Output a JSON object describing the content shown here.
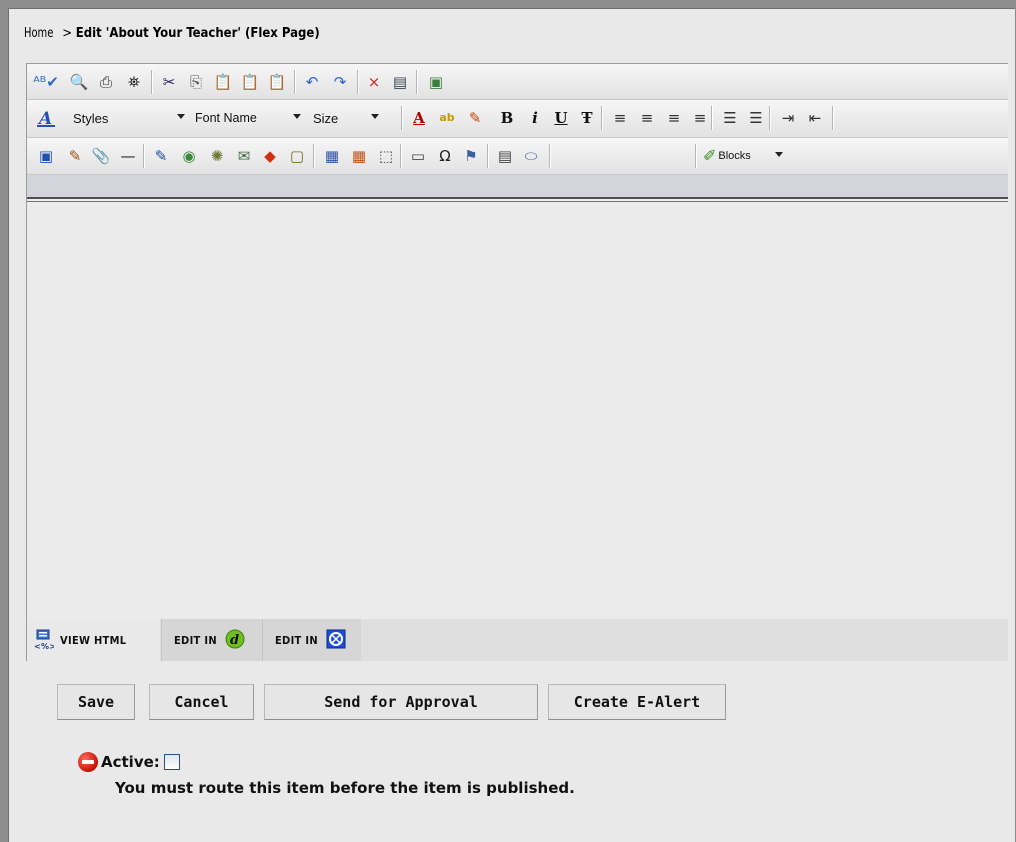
{
  "breadcrumb": {
    "home": "Home",
    "separator": " > ",
    "current": "Edit 'About Your Teacher' (Flex Page)"
  },
  "toolbar": {
    "row1": [
      {
        "name": "spellcheck-icon",
        "glyph": "ᴬᴮ✔",
        "color": "#2a6bbd"
      },
      {
        "name": "find-icon",
        "glyph": "🔍",
        "color": "#345"
      },
      {
        "name": "print-icon",
        "glyph": "⎙",
        "color": "#333"
      },
      {
        "name": "binoculars-icon",
        "glyph": "⛯",
        "color": "#222"
      },
      {
        "name": "cut-icon",
        "glyph": "✂",
        "color": "#225"
      },
      {
        "name": "copy-icon",
        "glyph": "⎘",
        "color": "#555"
      },
      {
        "name": "paste-icon",
        "glyph": "📋",
        "color": "#8a5a1a"
      },
      {
        "name": "paste-word-icon",
        "glyph": "📋",
        "color": "#2a56a5"
      },
      {
        "name": "paste-text-icon",
        "glyph": "📋",
        "color": "#666"
      },
      {
        "name": "undo-icon",
        "glyph": "↶",
        "color": "#2e62c9"
      },
      {
        "name": "redo-icon",
        "glyph": "↷",
        "color": "#2e62c9"
      },
      {
        "name": "delete-icon",
        "glyph": "×",
        "color": "#e02020"
      },
      {
        "name": "select-all-icon",
        "glyph": "▤",
        "color": "#345"
      },
      {
        "name": "preview-icon",
        "glyph": "▣",
        "color": "#3b7d3b"
      }
    ],
    "styles_label": "Styles",
    "font_name_label": "Font Name",
    "size_label": "Size",
    "format_icons": [
      {
        "name": "font-color-icon",
        "glyph": "A",
        "color": "#b00000"
      },
      {
        "name": "highlight-icon",
        "glyph": "ab",
        "color": "#c79a00"
      },
      {
        "name": "format-brush-icon",
        "glyph": "✎",
        "color": "#d04010"
      },
      {
        "name": "bold-icon",
        "glyph": "B",
        "color": "#111"
      },
      {
        "name": "italic-icon",
        "glyph": "i",
        "color": "#111"
      },
      {
        "name": "underline-icon",
        "glyph": "U",
        "color": "#111"
      },
      {
        "name": "strikethrough-icon",
        "glyph": "Ŧ",
        "color": "#111"
      },
      {
        "name": "align-left-icon",
        "glyph": "≡",
        "color": "#333"
      },
      {
        "name": "align-center-icon",
        "glyph": "≡",
        "color": "#333"
      },
      {
        "name": "align-right-icon",
        "glyph": "≡",
        "color": "#333"
      },
      {
        "name": "justify-icon",
        "glyph": "≡",
        "color": "#333"
      },
      {
        "name": "numbered-list-icon",
        "glyph": "☰",
        "color": "#333"
      },
      {
        "name": "bullet-list-icon",
        "glyph": "☰",
        "color": "#333"
      },
      {
        "name": "indent-icon",
        "glyph": "⇥",
        "color": "#333"
      },
      {
        "name": "outdent-icon",
        "glyph": "⇤",
        "color": "#333"
      }
    ],
    "row3": [
      {
        "name": "image-icon",
        "glyph": "▣",
        "color": "#2050b0"
      },
      {
        "name": "edit-image-icon",
        "glyph": "✎",
        "color": "#a05010"
      },
      {
        "name": "attachment-icon",
        "glyph": "📎",
        "color": "#444"
      },
      {
        "name": "horizontal-rule-icon",
        "glyph": "—",
        "color": "#222"
      },
      {
        "name": "hyperlink-icon",
        "glyph": "✎",
        "color": "#1b4da0"
      },
      {
        "name": "library-link-icon",
        "glyph": "◉",
        "color": "#3a8a3a"
      },
      {
        "name": "edit-link-icon",
        "glyph": "✺",
        "color": "#6a7a2a"
      },
      {
        "name": "quicklink-icon",
        "glyph": "✉",
        "color": "#406a40"
      },
      {
        "name": "bookmark-icon",
        "glyph": "◆",
        "color": "#d03010"
      },
      {
        "name": "form-icon",
        "glyph": "▢",
        "color": "#6a6a20"
      },
      {
        "name": "table-icon",
        "glyph": "▦",
        "color": "#2a4fa5"
      },
      {
        "name": "table-edit-icon",
        "glyph": "▦",
        "color": "#c05010"
      },
      {
        "name": "table-borders-icon",
        "glyph": "⬚",
        "color": "#444"
      },
      {
        "name": "text-box-icon",
        "glyph": "▭",
        "color": "#444"
      },
      {
        "name": "special-char-icon",
        "glyph": "Ω",
        "color": "#222"
      },
      {
        "name": "ruler-icon",
        "glyph": "⚑",
        "color": "#3b5fa0"
      },
      {
        "name": "properties-icon",
        "glyph": "▤",
        "color": "#444"
      },
      {
        "name": "eraser-icon",
        "glyph": "⬭",
        "color": "#4a6fa0"
      }
    ],
    "blocks_label": "Blocks"
  },
  "mode_tabs": {
    "view_html": "VIEW HTML",
    "edit_in_1": "EDIT IN",
    "edit_in_2": "EDIT IN"
  },
  "buttons": {
    "save": "Save",
    "cancel": "Cancel",
    "send_for_approval": "Send for Approval",
    "create_ealert": "Create E-Alert"
  },
  "status": {
    "active_label": "Active:",
    "route_note": "You must route this item before the item is published."
  }
}
